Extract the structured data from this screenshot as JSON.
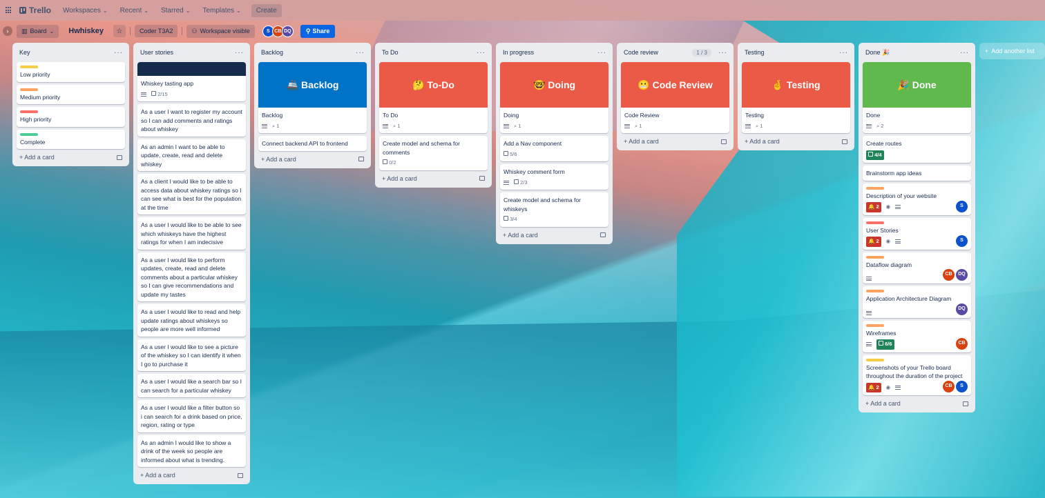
{
  "topbar": {
    "logo": "Trello",
    "nav": [
      "Workspaces",
      "Recent",
      "Starred",
      "Templates"
    ],
    "create": "Create"
  },
  "boardbar": {
    "view": "Board",
    "title": "Hwhiskey",
    "workspace": "Coder T3A2",
    "visibility": "Workspace visible",
    "avatars": [
      "S",
      "CB",
      "DQ"
    ],
    "share": "Share"
  },
  "add_card": "Add a card",
  "add_list": "Add another list",
  "lists": {
    "key": {
      "title": "Key",
      "cards": [
        "Low priority",
        "Medium priority",
        "High priority",
        "Complete"
      ]
    },
    "user_stories": {
      "title": "User stories",
      "c0": "Whiskey tasting app",
      "c0_check": "2/15",
      "c1": "As a user I want to register my account so I can add comments and ratings about whiskey",
      "c2": "As an admin I want to be able to update, create, read and delete whiskey",
      "c3": "As a client I would like to be able to access data about whiskey ratings so I can see what is best for the population at the time",
      "c4": "As a user I would like to be able to see which whiskeys have the highest ratings for when I am indecisive",
      "c5": "As a user I would like to perform updates, create, read and delete comments about a particular whiskey so I can give recommendations and update my tastes",
      "c6": "As a user I would like to read and help update ratings about whiskeys so people are more well informed",
      "c7": "As a user I would like to see a picture of the whiskey so I can identify it when I go to purchase it",
      "c8": "As a user I would like a search bar so I can search for a particular whiskey",
      "c9": "As a user I would like a filter button so i can search for a drink based on price, region, rating or type",
      "c10": "As an admin I would like to show a drink of the week so people are informed about what is trending."
    },
    "backlog": {
      "title": "Backlog",
      "cover_emoji": "🚢",
      "cover": "Backlog",
      "c0": "Backlog",
      "c0_attach": "1",
      "c1": "Connect backend API to frontend"
    },
    "todo": {
      "title": "To Do",
      "cover_emoji": "🤔",
      "cover": "To-Do",
      "c0": "To Do",
      "c0_attach": "1",
      "c1": "Create model and schema for comments",
      "c1_check": "0/2"
    },
    "progress": {
      "title": "In progress",
      "cover_emoji": "🤓",
      "cover": "Doing",
      "c0": "Doing",
      "c0_attach": "1",
      "c1": "Add a Nav component",
      "c1_check": "5/6",
      "c2": "Whiskey comment form",
      "c2_check": "2/3",
      "c3": "Create model and schema for whiskeys",
      "c3_check": "3/4"
    },
    "review": {
      "title": "Code review",
      "count": "1 / 3",
      "cover_emoji": "😬",
      "cover": "Code Review",
      "c0": "Code Review",
      "c0_attach": "1"
    },
    "testing": {
      "title": "Testing",
      "cover_emoji": "🤞",
      "cover": "Testing",
      "c0": "Testing",
      "c0_attach": "1"
    },
    "done": {
      "title": "Done 🎉",
      "cover_emoji": "🎉",
      "cover": "Done",
      "c0": "Done",
      "c0_attach": "2",
      "c1": "Create routes",
      "c1_check": "4/4",
      "c2": "Brainstorm app ideas",
      "c3": "Description of your website",
      "c3_notif": "2",
      "c4": "User Stories",
      "c4_notif": "2",
      "c5": "Dataflow diagram",
      "c6": "Application Architecture Diagram",
      "c7": "Wireframes",
      "c7_check": "6/6",
      "c8": "Screenshots of your Trello board throughout the duration of the project",
      "c8_notif": "2"
    }
  },
  "colors": {
    "yellow": "#f5cd47",
    "orange": "#fea362",
    "red": "#f87168",
    "green": "#4bce97",
    "cover_blue": "#0073c6",
    "cover_red": "#ea5a47",
    "cover_green": "#5fb94d"
  }
}
